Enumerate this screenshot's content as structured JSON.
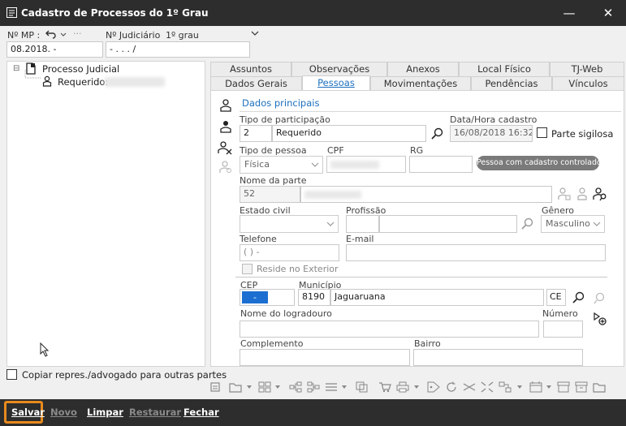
{
  "window": {
    "title": "Cadastro de Processos do 1º Grau",
    "minimize": "—",
    "close": "✕"
  },
  "top": {
    "nmp_label": "Nº MP :",
    "nmp_value": "08.2018.        -",
    "judiciario_label": "Nº Judiciário",
    "grau_label": "1º grau",
    "judiciario_value": "       -   .    .  .     /"
  },
  "tree": {
    "root": "Processo Judicial",
    "child_label": "Requerido:",
    "expander": "⊟"
  },
  "tabs_top": [
    "Assuntos",
    "Observações",
    "Anexos",
    "Local Físico",
    "TJ-Web"
  ],
  "tabs_bottom": [
    "Dados Gerais",
    "Pessoas",
    "Movimentações",
    "Pendências",
    "Vínculos"
  ],
  "subtab": "Dados principais",
  "form": {
    "tipo_participacao_label": "Tipo de participação",
    "tipo_participacao_code": "2",
    "tipo_participacao_value": "Requerido",
    "data_hora_label": "Data/Hora cadastro",
    "data_hora_value": "16/08/2018 16:32",
    "parte_sigilosa_label": "Parte sigilosa",
    "tipo_pessoa_label": "Tipo de pessoa",
    "tipo_pessoa_value": "Física",
    "cpf_label": "CPF",
    "rg_label": "RG",
    "controlado_label": "Pessoa com cadastro controlado",
    "nome_parte_label": "Nome da parte",
    "nome_parte_code": "52",
    "estado_civil_label": "Estado civil",
    "profissao_label": "Profissão",
    "genero_label": "Gênero",
    "genero_value": "Masculino",
    "telefone_label": "Telefone",
    "telefone_value": "(  )    -",
    "email_label": "E-mail",
    "reside_exterior_label": "Reside no Exterior",
    "cep_label": "CEP",
    "cep_value": "-",
    "municipio_label": "Município",
    "municipio_code": "8190",
    "municipio_value": "Jaguaruana",
    "uf_value": "CE",
    "logradouro_label": "Nome do logradouro",
    "numero_label": "Número",
    "complemento_label": "Complemento",
    "bairro_label": "Bairro"
  },
  "copiar_label": "Copiar repres./advogado para outras partes",
  "buttons": {
    "salvar": "Salvar",
    "novo": "Novo",
    "limpar": "Limpar",
    "restaurar": "Restaurar",
    "fechar": "Fechar"
  },
  "colors": {
    "titlebar": "#2d2d2d",
    "accent": "#1d6fbd",
    "highlight": "#e78a1e",
    "cep_fill": "#1c6fd1"
  }
}
